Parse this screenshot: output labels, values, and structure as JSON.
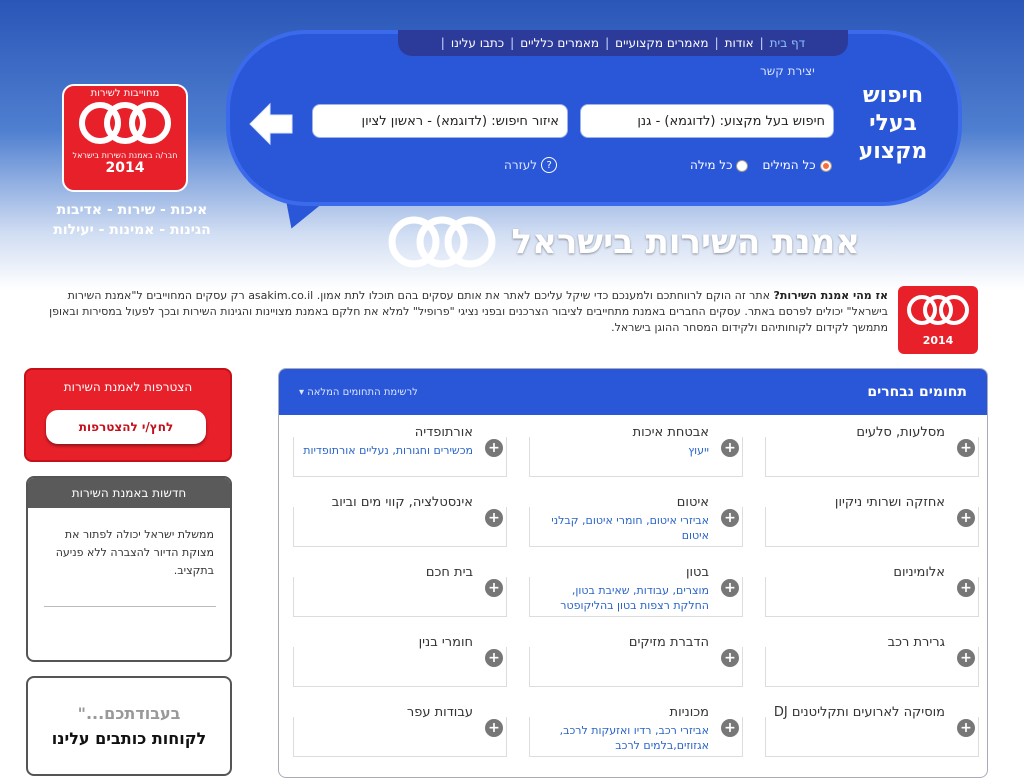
{
  "nav": {
    "items": [
      "דף בית",
      "אודות",
      "מאמרים מקצועיים",
      "מאמרים כלליים",
      "כתבו עלינו"
    ],
    "separator": "|"
  },
  "search": {
    "title_line1": "חיפוש",
    "title_line2": "בעלי",
    "title_line3": "מקצוע",
    "quick_contact": "יצירת קשר",
    "profession_value": "חיפוש בעל מקצוע: (לדוגמא) - גנן",
    "area_value": "איזור חיפוש: (לדוגמא) - ראשון לציון",
    "radio_all": "כל המילים",
    "radio_any": "כל מילה",
    "help": "לעזרה"
  },
  "logo": {
    "top_text": "מחוייבות לשירות",
    "bottom_text": "חבר/ה באמנת השירות בישראל",
    "year": "2014",
    "slogan_line1": "איכות - שירות - אדיבות",
    "slogan_line2": "הגינות - אמינות - יעילות"
  },
  "brand": {
    "name": "אמנת השירות בישראל"
  },
  "about": {
    "question": "אז מהי אמנת השירות?",
    "text": " אתר זה הוקם לרווחתכם ולמענכם כדי שיקל עליכם לאתר את אותם עסקים בהם תוכלו לתת אמון. asakim.co.il רק עסקים המחוייבים ל\"אמנת השירות בישראל\" יכולים לפרסם באתר. עסקים החברים באמנת מתחייבים לציבור הצרכנים ובפני נציגי \"פרופיל\" למלא את חלקם באמנת מצויינות והגינות השירות ובכך לפעול במסירות ובאופן מתמשך לקידום לקוחותיהם ולקידום המסחר ההוגן בישראל."
  },
  "join": {
    "title": "הצטרפות לאמנת השירות",
    "button": "לחץ/י להצטרפות"
  },
  "news": {
    "title": "חדשות באמנת השירות",
    "item": "ממשלת ישראל יכולה לפתור את מצוקת הדיור להצברה ללא פניעה בתקציב."
  },
  "testimonials": {
    "subtitle": "בעבודתכם...\"",
    "title": "לקוחות כותבים עלינו"
  },
  "categories": {
    "title": "תחומים נבחרים",
    "full_list_link": "לרשימת התחומים המלאה",
    "items": [
      {
        "name": "מסלעות, סלעים",
        "subs": ""
      },
      {
        "name": "אבטחת איכות",
        "subs": "ייעוץ"
      },
      {
        "name": "אורתופדיה",
        "subs": "מכשירים וחגורות, נעליים אורתופדיות"
      },
      {
        "name": "אחזקה ושרותי ניקיון",
        "subs": ""
      },
      {
        "name": "איטום",
        "subs": "אביזרי איטום, חומרי איטום, קבלני איטום"
      },
      {
        "name": "אינסטלציה, קווי מים וביוב",
        "subs": ""
      },
      {
        "name": "אלומיניום",
        "subs": ""
      },
      {
        "name": "בטון",
        "subs": "מוצרים, עבודות, שאיבת בטון, החלקת רצפות בטון בהליקופטר"
      },
      {
        "name": "בית חכם",
        "subs": ""
      },
      {
        "name": "גרירת רכב",
        "subs": ""
      },
      {
        "name": "הדברת מזיקים",
        "subs": ""
      },
      {
        "name": "חומרי בנין",
        "subs": ""
      },
      {
        "name": "מוסיקה לארועים ותקליטנים DJ",
        "subs": ""
      },
      {
        "name": "מכוניות",
        "subs": "אביזרי רכב, רדיו ואזעקות לרכב, אגזוזים,בלמים לרכב"
      },
      {
        "name": "עבודות עפר",
        "subs": ""
      }
    ]
  },
  "colors": {
    "primary_blue": "#2a56d8",
    "brand_red": "#e8202a"
  }
}
